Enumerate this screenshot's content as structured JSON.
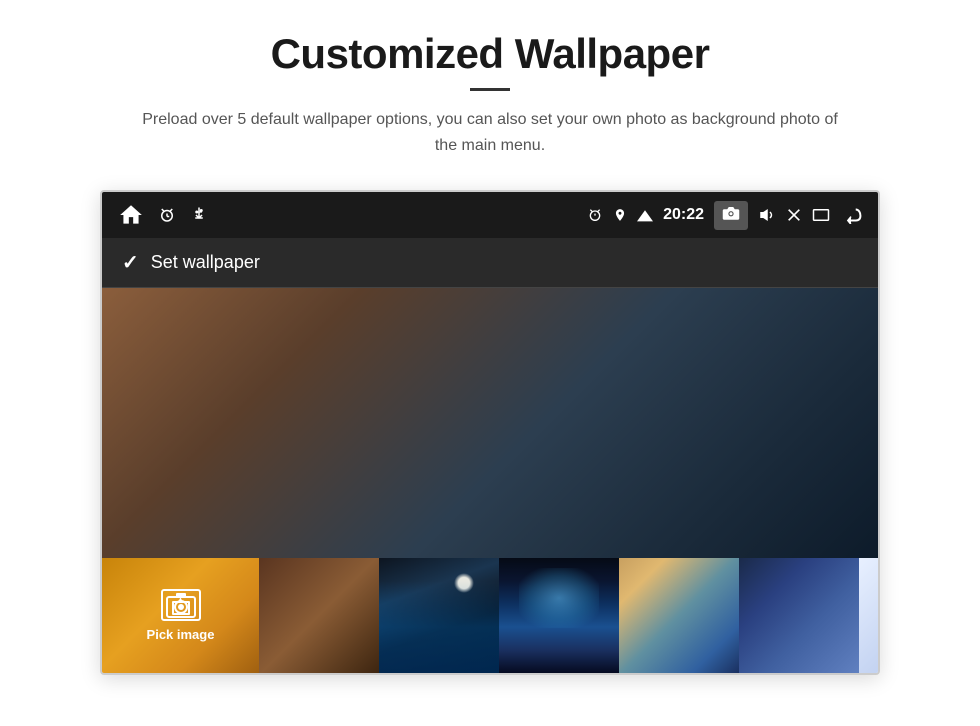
{
  "header": {
    "title": "Customized Wallpaper",
    "divider": "",
    "subtitle": "Preload over 5 default wallpaper options, you can also set your own photo as background photo of the main menu."
  },
  "statusBar": {
    "time": "20:22",
    "icons": {
      "home": "⌂",
      "alarm": "⏰",
      "usb": "⚡",
      "gps": "📍",
      "wifi": "▼",
      "camera": "📷",
      "volume": "🔊",
      "close": "✕",
      "window": "▭",
      "back": "↩"
    }
  },
  "actionBar": {
    "checkmark": "✓",
    "label": "Set wallpaper"
  },
  "thumbnails": {
    "pickImage": "Pick image"
  }
}
